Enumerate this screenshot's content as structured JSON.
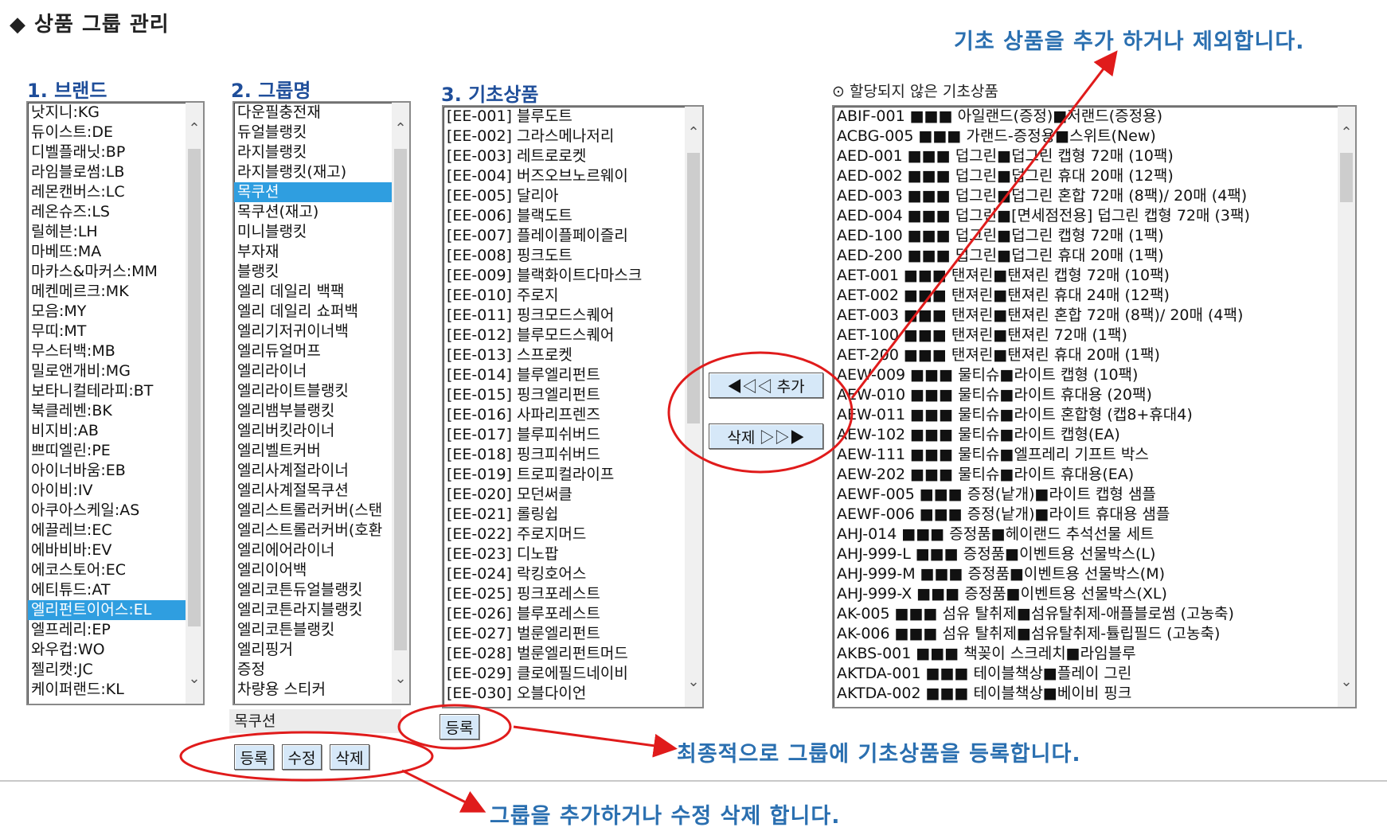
{
  "page": {
    "title": "◆ 상품 그룹 관리"
  },
  "sections": {
    "brand": "1. 브랜드",
    "group": "2. 그룹명",
    "base": "3. 기초상품",
    "unassigned": "⊙ 할당되지 않은 기초상품"
  },
  "brands": [
    "낫지니:KG",
    "듀이스트:DE",
    "디벨플래닛:BP",
    "라임블로썸:LB",
    "레몬캔버스:LC",
    "레온슈즈:LS",
    "릴헤븐:LH",
    "마베뜨:MA",
    "마카스&마커스:MM",
    "메켄메르크:MK",
    "모음:MY",
    "무띠:MT",
    "무스터백:MB",
    "밀로앤개비:MG",
    "보타니컬테라피:BT",
    "북클레벤:BK",
    "비지비:AB",
    "쁘띠엘린:PE",
    "아이너바움:EB",
    "아이비:IV",
    "아쿠아스케일:AS",
    "에끌레브:EC",
    "에바비바:EV",
    "에코스토어:EC",
    "에티튜드:AT",
    "엘리펀트이어스:EL",
    "엘프레리:EP",
    "와우컵:WO",
    "젤리캣:JC",
    "케이퍼랜드:KL"
  ],
  "brand_selected": 25,
  "groups": [
    "다운필충전재",
    "듀얼블랭킷",
    "라지블랭킷",
    "라지블랭킷(재고)",
    "목쿠션",
    "목쿠션(재고)",
    "미니블랭킷",
    "부자재",
    "블랭킷",
    "엘리 데일리 백팩",
    "엘리 데일리 쇼퍼백",
    "엘리기저귀이너백",
    "엘리듀얼머프",
    "엘리라이너",
    "엘리라이트블랭킷",
    "엘리뱀부블랭킷",
    "엘리버킷라이너",
    "엘리벨트커버",
    "엘리사계절라이너",
    "엘리사계절목쿠션",
    "엘리스트롤러커버(스탠",
    "엘리스트롤러커버(호환",
    "엘리에어라이너",
    "엘리이어백",
    "엘리코튼듀얼블랭킷",
    "엘리코튼라지블랭킷",
    "엘리코튼블랭킷",
    "엘리핑거",
    "증정",
    "차량용 스티커"
  ],
  "group_selected": 4,
  "group_input_value": "목쿠션",
  "base_products": [
    "[EE-001] 블루도트",
    "[EE-002] 그라스메나저리",
    "[EE-003] 레트로로켓",
    "[EE-004] 버즈오브노르웨이",
    "[EE-005] 달리아",
    "[EE-006] 블랙도트",
    "[EE-007] 플레이플페이즐리",
    "[EE-008] 핑크도트",
    "[EE-009] 블랙화이트다마스크",
    "[EE-010] 주로지",
    "[EE-011] 핑크모드스퀘어",
    "[EE-012] 블루모드스퀘어",
    "[EE-013] 스프로켓",
    "[EE-014] 블루엘리펀트",
    "[EE-015] 핑크엘리펀트",
    "[EE-016] 사파리프렌즈",
    "[EE-017] 블루피쉬버드",
    "[EE-018] 핑크피쉬버드",
    "[EE-019] 트로피컬라이프",
    "[EE-020] 모던써클",
    "[EE-021] 롤링쉽",
    "[EE-022] 주로지머드",
    "[EE-023] 디노팝",
    "[EE-024] 락킹호어스",
    "[EE-025] 핑크포레스트",
    "[EE-026] 블루포레스트",
    "[EE-027] 벌룬엘리펀트",
    "[EE-028] 벌룬엘리펀트머드",
    "[EE-029] 클로에필드네이비",
    "[EE-030] 오블다이언"
  ],
  "unassigned": [
    "ABIF-001 ■■■ 아일랜드(증정)■저랜드(증정용)",
    "ACBG-005 ■■■ 가랜드-증정용■스위트(New)",
    "AED-001 ■■■ 덥그린■덥그린 캡형 72매 (10팩)",
    "AED-002 ■■■ 덥그린■덥그린 휴대 20매 (12팩)",
    "AED-003 ■■■ 덥그린■덥그린 혼합 72매 (8팩)/ 20매 (4팩)",
    "AED-004 ■■■ 덥그린■[면세점전용] 덥그린 캡형 72매 (3팩)",
    "AED-100 ■■■ 덥그린■덥그린 캡형 72매 (1팩)",
    "AED-200 ■■■ 덥그린■덥그린 휴대 20매 (1팩)",
    "AET-001 ■■■ 탠져린■탠져린 캡형 72매 (10팩)",
    "AET-002 ■■■ 탠져린■탠져린 휴대 24매 (12팩)",
    "AET-003 ■■■ 탠져린■탠져린 혼합 72매 (8팩)/ 20매 (4팩)",
    "AET-100 ■■■ 탠져린■탠져린 72매 (1팩)",
    "AET-200 ■■■ 탠져린■탠져린 휴대 20매 (1팩)",
    "AEW-009 ■■■ 물티슈■라이트 캡형 (10팩)",
    "AEW-010 ■■■ 물티슈■라이트 휴대용 (20팩)",
    "AEW-011 ■■■ 물티슈■라이트 혼합형 (캡8+휴대4)",
    "AEW-102 ■■■ 물티슈■라이트 캡형(EA)",
    "AEW-111 ■■■ 물티슈■엘프레리 기프트 박스",
    "AEW-202 ■■■ 물티슈■라이트 휴대용(EA)",
    "AEWF-005 ■■■ 증정(낱개)■라이트 캡형 샘플",
    "AEWF-006 ■■■ 증정(낱개)■라이트 휴대용 샘플",
    "AHJ-014 ■■■ 증정품■헤이랜드 추석선물 세트",
    "AHJ-999-L ■■■ 증정품■이벤트용 선물박스(L)",
    "AHJ-999-M ■■■ 증정품■이벤트용 선물박스(M)",
    "AHJ-999-X ■■■ 증정품■이벤트용 선물박스(XL)",
    "AK-005 ■■■ 섬유 탈취제■섬유탈취제-애플블로썸 (고농축)",
    "AK-006 ■■■ 섬유 탈취제■섬유탈취제-튤립필드 (고농축)",
    "AKBS-001 ■■■ 책꽂이 스크레치■라임블루",
    "AKTDA-001 ■■■ 테이블책상■플레이 그린",
    "AKTDA-002 ■■■ 테이블책상■베이비 핑크"
  ],
  "buttons": {
    "add": "◀◁◁ 추가",
    "remove": "삭제 ▷▷▶",
    "register_base": "등록",
    "group_register": "등록",
    "group_edit": "수정",
    "group_delete": "삭제"
  },
  "annotations": {
    "top": "기초 상품을 추가 하거나 제외합니다.",
    "middle": "최종적으로 그룹에 기초상품을 등록합니다.",
    "bottom": "그룹을 추가하거나 수정 삭제 합니다."
  },
  "colors": {
    "annotation_line": "#e01b1b",
    "annotation_text": "#2a6fb0",
    "selection": "#2f9ee0"
  }
}
